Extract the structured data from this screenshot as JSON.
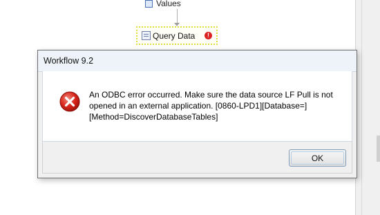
{
  "canvas": {
    "previous_node_label": "Values",
    "query_node_label": "Query Data",
    "query_node_icon": "query-icon",
    "query_node_status": "error-badge-icon"
  },
  "dialog": {
    "title": "Workflow 9.2",
    "icon": "error-x-icon",
    "message": "An ODBC error occurred. Make sure the data source LF Pull is not opened in an external application. [0860-LPD1][Database=][Method=DiscoverDatabaseTables]",
    "ok_label": "OK"
  },
  "colors": {
    "error_red": "#d9261c",
    "selection_highlight": "#e2dc3c",
    "button_border": "#7e9ab4"
  }
}
